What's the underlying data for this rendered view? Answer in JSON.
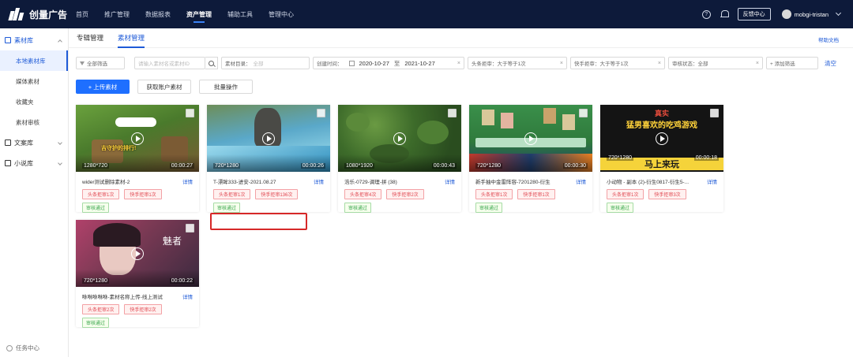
{
  "app": {
    "logo_text": "创量广告"
  },
  "nav": [
    {
      "label": "首页",
      "active": false
    },
    {
      "label": "推广管理",
      "active": false
    },
    {
      "label": "数据报表",
      "active": false
    },
    {
      "label": "资产管理",
      "active": true
    },
    {
      "label": "辅助工具",
      "active": false
    },
    {
      "label": "管理中心",
      "active": false
    }
  ],
  "topbar": {
    "help_icon": "?",
    "feedback_label": "反馈中心",
    "username": "mobgi-tristan"
  },
  "sidebar": {
    "groups": [
      {
        "label": "素材库",
        "items": [
          "本地素材库",
          "媒体素材",
          "收藏夹",
          "素材审核"
        ]
      },
      {
        "label": "文案库",
        "items": []
      },
      {
        "label": "小说库",
        "items": []
      }
    ],
    "task_center": "任务中心"
  },
  "tabs": [
    "专辑管理",
    "素材管理"
  ],
  "help_link": "帮助文档",
  "filters": {
    "all_filter": "全部筛选",
    "search_placeholder": "请输入素材名或素材ID",
    "dir_label": "素材目录：",
    "dir_value": "全部",
    "time_label": "创建时间：",
    "date_start": "2020-10-27",
    "date_sep": "至",
    "date_end": "2021-10-27",
    "toutiao_reject": "头条拒审：大于等于1次",
    "kuaishou_reject": "快手拒审：大于等于1次",
    "review_status": "审核状态：全部",
    "add_filter": "+ 添加筛选",
    "clear": "清空"
  },
  "actions": {
    "upload": "+ 上传素材",
    "fetch": "获取账户素材",
    "batch": "批量操作"
  },
  "cards": [
    {
      "title": "wider测试删除素材-2",
      "resolution": "1280*720",
      "duration": "00:00:27",
      "detail": "详情",
      "toutiao": "头条拒审1次",
      "kuaishou": "快手拒审1次",
      "status": "审核通过",
      "thumb_color": "#4a7a2c"
    },
    {
      "title": "T-漂眸333-进安-2021.08.27",
      "resolution": "720*1280",
      "duration": "00:00:26",
      "detail": "详情",
      "toutiao": "头条拒审1次",
      "kuaishou": "快手拒审136次",
      "status": "审核通过",
      "thumb_color": "#4fa3c7"
    },
    {
      "title": "浩乐-0729-调理-拼 (38)",
      "resolution": "1080*1920",
      "duration": "00:00:43",
      "detail": "详情",
      "toutiao": "头条拒审4次",
      "kuaishou": "快手拒审2次",
      "status": "审核通过",
      "thumb_color": "#3d6b2a"
    },
    {
      "title": "新手抽中金雷阵容-7201280-衍生",
      "resolution": "720*1280",
      "duration": "00:00:30",
      "detail": "详情",
      "toutiao": "头条拒审1次",
      "kuaishou": "快手拒审1次",
      "status": "审核通过",
      "thumb_color": "#2f7a3c"
    },
    {
      "title": "小动物 - 副本 (2)-衍生0817-衍生5-...",
      "resolution": "720*1280",
      "duration": "00:00:18",
      "detail": "详情",
      "toutiao": "头条拒审1次",
      "kuaishou": "快手拒审3次",
      "status": "审核通过",
      "thumb_color": "#1a1a1a"
    },
    {
      "title": "咻咻咻咻咻-素材名称上传-线上测试",
      "resolution": "720*1280",
      "duration": "00:00:22",
      "detail": "详情",
      "toutiao": "头条拒审2次",
      "kuaishou": "快手拒审2次",
      "status": "审核通过",
      "thumb_color": "#7d3a55"
    }
  ],
  "thumb_text": {
    "card1_caption": "吉守护的排行!",
    "card5_line1": "真实",
    "card5_line2": "猛男喜欢的吃鸡游戏",
    "card5_line3": "马上来玩",
    "card6_text": "魅者"
  }
}
